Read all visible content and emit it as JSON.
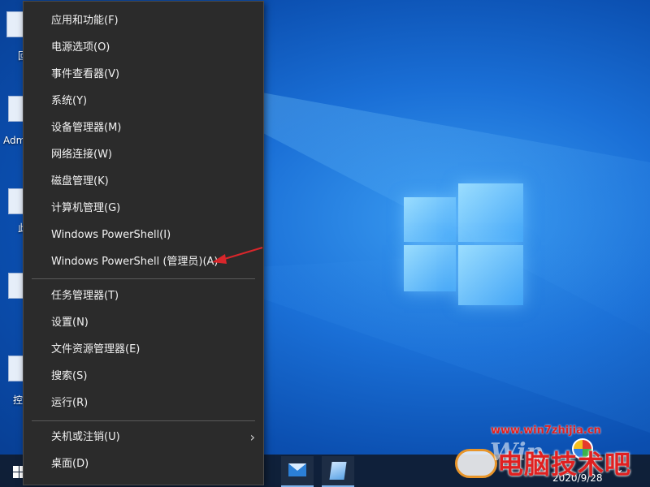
{
  "desktop": {
    "icons": [
      {
        "label": "回"
      },
      {
        "label": "Adm"
      },
      {
        "label": "此"
      },
      {
        "label": ""
      },
      {
        "label": "控"
      }
    ]
  },
  "context_menu": {
    "group1": [
      {
        "label": "应用和功能(F)"
      },
      {
        "label": "电源选项(O)"
      },
      {
        "label": "事件查看器(V)"
      },
      {
        "label": "系统(Y)"
      },
      {
        "label": "设备管理器(M)"
      },
      {
        "label": "网络连接(W)"
      },
      {
        "label": "磁盘管理(K)"
      },
      {
        "label": "计算机管理(G)"
      },
      {
        "label": "Windows PowerShell(I)"
      },
      {
        "label": "Windows PowerShell (管理员)(A)"
      }
    ],
    "group2": [
      {
        "label": "任务管理器(T)"
      },
      {
        "label": "设置(N)"
      },
      {
        "label": "文件资源管理器(E)"
      },
      {
        "label": "搜索(S)"
      },
      {
        "label": "运行(R)"
      }
    ],
    "group3": [
      {
        "label": "关机或注销(U)"
      },
      {
        "label": "桌面(D)"
      }
    ],
    "submenu_arrow": "›"
  },
  "annotation": {
    "arrow_color": "#d9262b"
  },
  "taskbar": {
    "apps": [
      {
        "icon": "mail-icon"
      },
      {
        "icon": "notepad-icon"
      }
    ],
    "tray_date": "2020/9/28",
    "tray_chevron": "⌄"
  },
  "watermark": {
    "url": "www.win7zhijia.cn",
    "brand": "电脑技术吧",
    "logo_text": "Win"
  },
  "colors": {
    "menu_bg": "#2b2b2b",
    "desktop_blue": "#1a6fd6",
    "watermark_red": "#e02020"
  }
}
